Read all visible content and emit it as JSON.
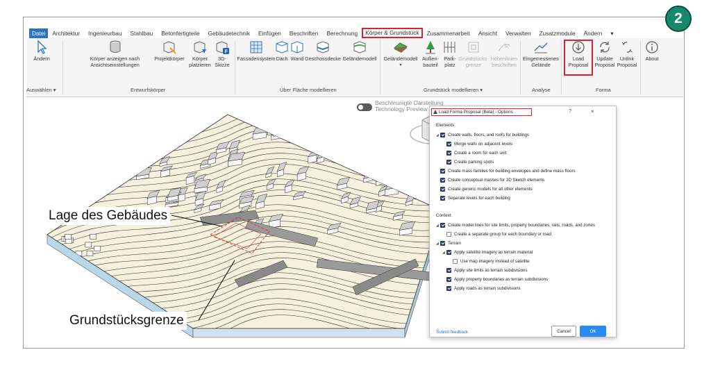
{
  "step_badge": "2",
  "menu": {
    "tabs": [
      "Datei",
      "Architektur",
      "Ingenieurbau",
      "Stahlbau",
      "Betonfertigteile",
      "Gebäudetechnik",
      "Einfügen",
      "Beschriften",
      "Berechnung",
      "Körper & Grundstück",
      "Zusammenarbeit",
      "Ansicht",
      "Verwalten",
      "Zusatzmodule",
      "Ändern"
    ],
    "active_tab": "Körper & Grundstück",
    "extra_dropdown": "▾"
  },
  "ribbon": {
    "select": {
      "label": "Ändern",
      "group": "Auswählen ▾"
    },
    "entwurf": {
      "group": "Entwurfskörper",
      "show_mass": "Körper anzeigen nach\nAnsichtseinstellungen",
      "project_mass": "Projektkörper",
      "place_mass": "Körper\nplatzieren",
      "sketch": "3D-\nSkizze"
    },
    "flaeche": {
      "group": "Über Fläche modellieren",
      "curtain": "Fassadensystem",
      "roof": "Dach",
      "wall": "Wand",
      "floor": "Geschossdecke",
      "terrain": "Geländemodell"
    },
    "grundstueck": {
      "group": "Grundstück modellieren ▾",
      "terrain": "Geländemodell",
      "site_comp": "Außen-\nbauteil",
      "parking": "Park-\nplatz",
      "boundary": "Grundstücks-\ngrenze",
      "label_contours": "Höhenlinien\nbeschriften"
    },
    "analyse": {
      "group": "Analyse",
      "graded": "Eingemessenes\nGelände"
    },
    "forma": {
      "group": "Forma",
      "load": "Load\nProposal",
      "update": "Update\nProposal",
      "unlink": "Unlink\nProposal"
    },
    "about": "About"
  },
  "viewport": {
    "preview_label": "Beschleunigte Darstellung\nTechnology Preview",
    "callout_building": "Lage des Gebäudes",
    "callout_boundary": "Grundstücksgrenze"
  },
  "dialog": {
    "title": "Load Forma Proposal (Beta) - Options",
    "help": "?",
    "close": "×",
    "elements_heading": "Elements",
    "elements": [
      {
        "label": "Create walls, floors, and roofs for buildings",
        "checked": true,
        "level": 0,
        "caret": true
      },
      {
        "label": "Merge walls on adjacent levels",
        "checked": true,
        "level": 1
      },
      {
        "label": "Create a room for each unit",
        "checked": true,
        "level": 1
      },
      {
        "label": "Create parking spots",
        "checked": true,
        "level": 1
      },
      {
        "label": "Create mass families for building envelopes and define mass floors",
        "checked": true,
        "level": 0
      },
      {
        "label": "Create conceptual masses for 3D Sketch elements",
        "checked": true,
        "level": 0
      },
      {
        "label": "Create generic models for all other elements",
        "checked": true,
        "level": 0
      },
      {
        "label": "Separate levels for each building",
        "checked": true,
        "level": 0
      }
    ],
    "context_heading": "Context",
    "context": [
      {
        "label": "Create model lines for site limits, property boundaries, rails, roads, and zones",
        "checked": true,
        "level": 0,
        "caret": true
      },
      {
        "label": "Create a separate group for each boundary or road",
        "checked": false,
        "level": 1
      },
      {
        "label": "Terrain",
        "checked": true,
        "level": 0,
        "caret": true
      },
      {
        "label": "Apply satellite imagery as terrain material",
        "checked": true,
        "level": 1,
        "caret": true
      },
      {
        "label": "Use map imagery instead of satellite",
        "checked": false,
        "level": 2
      },
      {
        "label": "Apply site limits as terrain subdivisions",
        "checked": true,
        "level": 1
      },
      {
        "label": "Apply property boundaries as terrain subdivisions",
        "checked": true,
        "level": 1
      },
      {
        "label": "Apply roads as terrain subdivisions",
        "checked": true,
        "level": 1
      }
    ],
    "feedback": "Submit feedback",
    "cancel": "Cancel",
    "ok": "OK"
  }
}
